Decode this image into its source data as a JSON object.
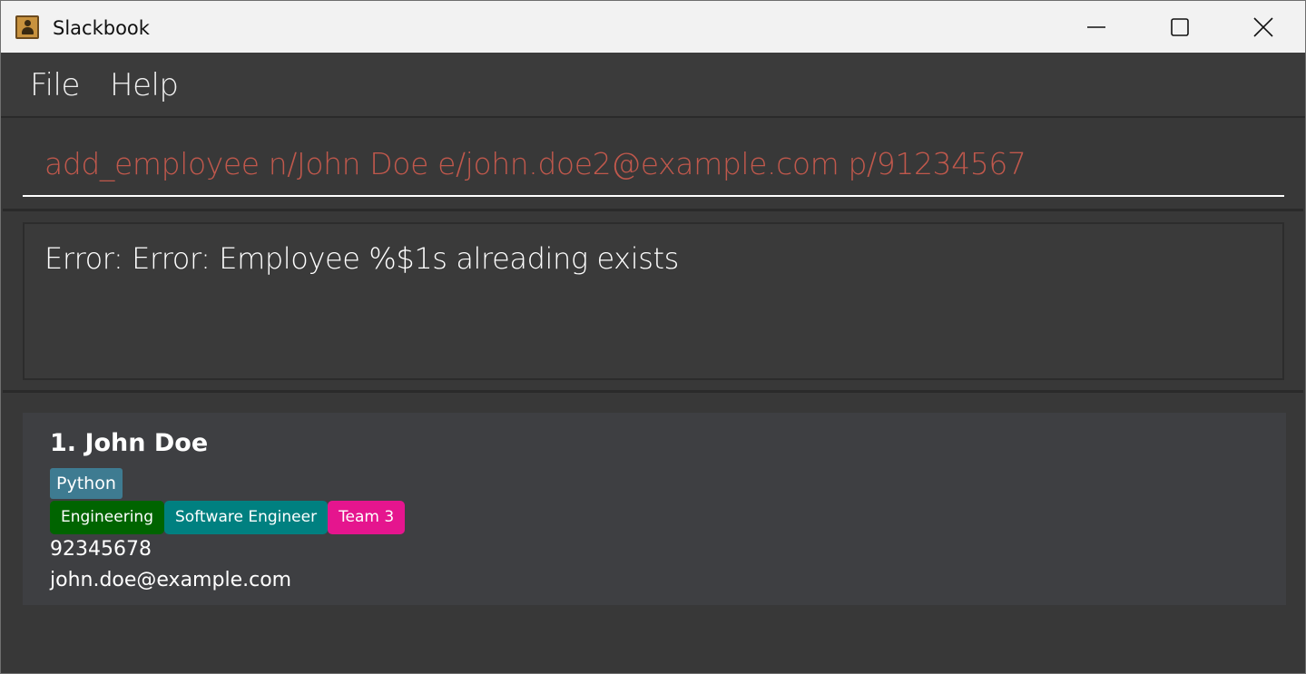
{
  "window": {
    "title": "Slackbook",
    "icon": "contact-book-icon"
  },
  "controls": {
    "minimize_icon": "minimize-icon",
    "maximize_icon": "maximize-icon",
    "close_icon": "close-icon"
  },
  "menu": {
    "items": [
      {
        "label": "File"
      },
      {
        "label": "Help"
      }
    ]
  },
  "command": {
    "value": "add_employee n/John Doe e/john.doe2@example.com p/91234567",
    "text_color": "#c0584c"
  },
  "result": {
    "message": "Error: Error: Employee %$1s alreading exists"
  },
  "employees": [
    {
      "index_name": "1. John Doe",
      "skills": [
        "Python"
      ],
      "tags": [
        {
          "label": "Engineering",
          "color": "#006400"
        },
        {
          "label": "Software Engineer",
          "color": "#008080"
        },
        {
          "label": "Team 3",
          "color": "#e5158e"
        }
      ],
      "phone": "92345678",
      "email": "john.doe@example.com"
    }
  ],
  "colors": {
    "background": "#383838",
    "card": "#3e3f42",
    "skill_tag": "#3e7b91",
    "titlebar": "#f2f2f2"
  }
}
